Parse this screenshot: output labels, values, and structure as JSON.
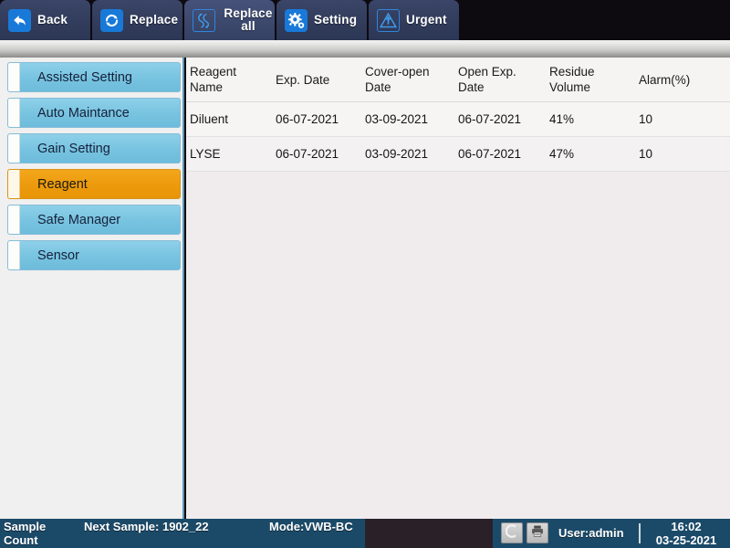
{
  "toolbar": {
    "tabs": [
      {
        "label": "Back",
        "icon": "back-arrow-icon",
        "active": false,
        "two_line": false
      },
      {
        "label": "Replace",
        "icon": "refresh-icon",
        "active": false,
        "two_line": false
      },
      {
        "label": "Replace all",
        "icon": "replace-all-icon",
        "active": true,
        "two_line": true
      },
      {
        "label": "Setting",
        "icon": "gear-icon",
        "active": false,
        "two_line": false
      },
      {
        "label": "Urgent",
        "icon": "warning-triangle-icon",
        "active": false,
        "two_line": false
      }
    ]
  },
  "sidebar": {
    "items": [
      {
        "label": "Assisted Setting",
        "selected": false
      },
      {
        "label": "Auto Maintance",
        "selected": false
      },
      {
        "label": "Gain Setting",
        "selected": false
      },
      {
        "label": "Reagent",
        "selected": true
      },
      {
        "label": "Safe Manager",
        "selected": false
      },
      {
        "label": "Sensor",
        "selected": false
      }
    ]
  },
  "table": {
    "columns": [
      "Reagent Name",
      "Exp. Date",
      "Cover-open Date",
      "Open Exp. Date",
      "Residue Volume",
      "Alarm(%)"
    ],
    "rows": [
      {
        "reagent_name": "Diluent",
        "exp_date": "06-07-2021",
        "cover_open_date": "03-09-2021",
        "open_exp_date": "06-07-2021",
        "residue_volume": "41%",
        "alarm": "10"
      },
      {
        "reagent_name": "LYSE",
        "exp_date": "06-07-2021",
        "cover_open_date": "03-09-2021",
        "open_exp_date": "06-07-2021",
        "residue_volume": "47%",
        "alarm": "10"
      }
    ]
  },
  "statusbar": {
    "sample_count_label": "Sample Count",
    "next_sample_label": "Next Sample: 1902_22",
    "mode_label": "Mode:VWB-BC",
    "user_label": "User:admin",
    "time": "16:02",
    "date": "03-25-2021",
    "status_icon": "status-circle-icon",
    "print_icon": "printer-icon"
  },
  "colors": {
    "toolbar_bg": "#0d0a10",
    "tab_bg": "#323c5c",
    "tab_active_bg": "#3c486c",
    "icon_blue": "#1879d8",
    "sidebar_item": "#77c3e0",
    "sidebar_selected": "#ec9a0d",
    "statusbar_bg": "#1b4a69",
    "status_dark_bg": "#2a2028",
    "content_bg": "#f0ecee"
  }
}
